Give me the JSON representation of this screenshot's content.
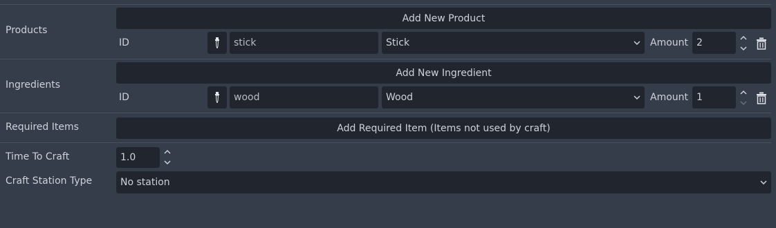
{
  "products": {
    "label": "Products",
    "add_button": "Add New Product",
    "row": {
      "id_label": "ID",
      "id_value": "stick",
      "item_select": "Stick",
      "amount_label": "Amount",
      "amount_value": "2"
    }
  },
  "ingredients": {
    "label": "Ingredients",
    "add_button": "Add New Ingredient",
    "row": {
      "id_label": "ID",
      "id_value": "wood",
      "item_select": "Wood",
      "amount_label": "Amount",
      "amount_value": "1"
    }
  },
  "required_items": {
    "label": "Required Items",
    "add_button": "Add Required Item (Items not used by craft)"
  },
  "time_to_craft": {
    "label": "Time To Craft",
    "value": "1.0"
  },
  "craft_station": {
    "label": "Craft Station Type",
    "value": "No station"
  },
  "icons": {
    "pick": "pipette-icon",
    "dropdown": "chevron-down-icon",
    "spinner": "spin-arrows-icon",
    "delete": "trash-icon"
  },
  "colors": {
    "background": "#363d4a",
    "field": "#21262e",
    "text": "#cdd2da",
    "separator": "#4a515e"
  }
}
